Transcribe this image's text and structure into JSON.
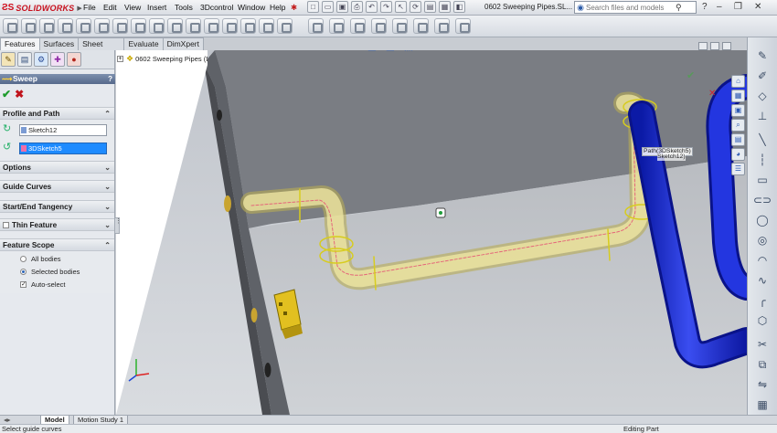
{
  "app": {
    "logo_ds": "ƧS",
    "logo_name": "SOLIDWORKS",
    "document_title": "0602 Sweeping Pipes.SL..."
  },
  "menu": [
    "File",
    "Edit",
    "View",
    "Insert",
    "Tools",
    "3Dcontrol",
    "Window",
    "Help"
  ],
  "search": {
    "placeholder": "Search files and models"
  },
  "command_tabs": [
    {
      "label": "Features",
      "active": true
    },
    {
      "label": "Surfaces",
      "active": false
    },
    {
      "label": "Sheet Metal",
      "active": false
    },
    {
      "label": "Evaluate",
      "active": false
    },
    {
      "label": "DimXpert",
      "active": false
    }
  ],
  "property_manager": {
    "title": "Sweep",
    "groups": {
      "profile_path": "Profile and Path",
      "options": "Options",
      "guide_curves": "Guide Curves",
      "start_end": "Start/End Tangency",
      "thin_feature": "Thin Feature",
      "feature_scope": "Feature Scope"
    },
    "profile_value": "Sketch12",
    "path_value": "3DSketch5",
    "scope_options": {
      "all_bodies": "All bodies",
      "selected_bodies": "Selected bodies",
      "auto_select": "Auto-select"
    }
  },
  "feature_tree": {
    "root": "0602 Sweeping Pipes (Defa..."
  },
  "viewport": {
    "path_tooltip": "Path(3DSketch5)",
    "path_tooltip2": "Sketch12)"
  },
  "bottom_tabs": [
    "Model",
    "Motion Study 1"
  ],
  "status": {
    "left": "Select guide curves",
    "right": "Editing Part"
  },
  "colors": {
    "accent_blue": "#1e8bff",
    "pipe_blue": "#1f2fd0",
    "preview_yellow": "#e9dc86"
  }
}
